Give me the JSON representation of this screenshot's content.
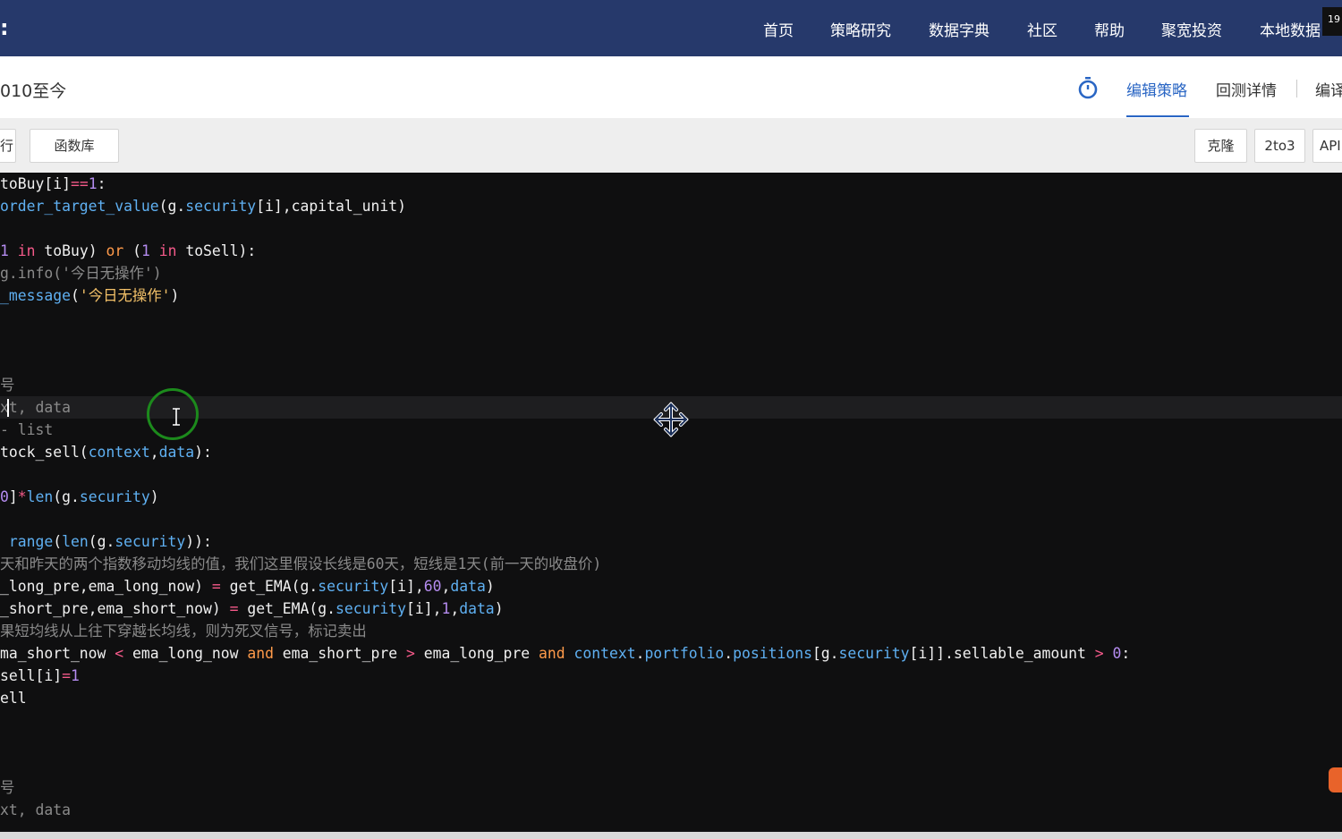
{
  "nav": {
    "logo_fragment": ":",
    "items": [
      "首页",
      "策略研究",
      "数据字典",
      "社区",
      "帮助",
      "聚宽投资",
      "本地数据"
    ],
    "corner_text": "19"
  },
  "title": {
    "text": "010至今",
    "tabs": [
      "编辑策略",
      "回测详情",
      "编译"
    ]
  },
  "toolbar": {
    "left_fragment": "行",
    "library": "函数库",
    "clone": "克隆",
    "py_convert": "2to3",
    "api": "API"
  },
  "editor": {
    "lines": [
      [
        [
          "toBuy[i]",
          "w"
        ],
        [
          "==",
          "kw"
        ],
        [
          "1",
          "num"
        ],
        [
          ":",
          "w"
        ]
      ],
      [
        [
          "order_target_value",
          "fn"
        ],
        [
          "(g.",
          "w"
        ],
        [
          "security",
          "fn"
        ],
        [
          "[i],capital_unit)",
          "w"
        ]
      ],
      [],
      [
        [
          "1 ",
          "num"
        ],
        [
          "in",
          "kw"
        ],
        [
          " toBuy) ",
          "w"
        ],
        [
          "or",
          "or"
        ],
        [
          " (",
          "w"
        ],
        [
          "1 ",
          "num"
        ],
        [
          "in",
          "kw"
        ],
        [
          " toSell):",
          "w"
        ]
      ],
      [
        [
          "g.info('今日无操作')",
          "cm"
        ]
      ],
      [
        [
          "_message",
          "fn"
        ],
        [
          "(",
          "w"
        ],
        [
          "'今日无操作'",
          "str"
        ],
        [
          ")",
          "w"
        ]
      ],
      [],
      [],
      [],
      [
        [
          "号",
          "cm"
        ]
      ],
      [
        [
          "xt, data",
          "cm"
        ]
      ],
      [
        [
          "- list",
          "cm"
        ]
      ],
      [
        [
          "tock_sell(",
          "w"
        ],
        [
          "context",
          "fn"
        ],
        [
          ",",
          "w"
        ],
        [
          "data",
          "fn"
        ],
        [
          "):",
          "w"
        ]
      ],
      [],
      [
        [
          "0",
          "num"
        ],
        [
          "]",
          "w"
        ],
        [
          "*",
          "kw"
        ],
        [
          "len",
          "fn"
        ],
        [
          "(g.",
          "w"
        ],
        [
          "security",
          "fn"
        ],
        [
          ")",
          "w"
        ]
      ],
      [],
      [
        [
          " ",
          "w"
        ],
        [
          "range",
          "fn"
        ],
        [
          "(",
          "w"
        ],
        [
          "len",
          "fn"
        ],
        [
          "(g.",
          "w"
        ],
        [
          "security",
          "fn"
        ],
        [
          ")):",
          "w"
        ]
      ],
      [
        [
          "天和昨天的两个指数移动均线的值，我们这里假设长线是60天，短线是1天(前一天的收盘价)",
          "cm"
        ]
      ],
      [
        [
          "_long_pre,ema_long_now) ",
          "w"
        ],
        [
          "=",
          "kw"
        ],
        [
          " get_EMA(g.",
          "w"
        ],
        [
          "security",
          "fn"
        ],
        [
          "[i],",
          "w"
        ],
        [
          "60",
          "num"
        ],
        [
          ",",
          "w"
        ],
        [
          "data",
          "fn"
        ],
        [
          ")",
          "w"
        ]
      ],
      [
        [
          "_short_pre,ema_short_now) ",
          "w"
        ],
        [
          "=",
          "kw"
        ],
        [
          " get_EMA(g.",
          "w"
        ],
        [
          "security",
          "fn"
        ],
        [
          "[i],",
          "w"
        ],
        [
          "1",
          "num"
        ],
        [
          ",",
          "w"
        ],
        [
          "data",
          "fn"
        ],
        [
          ")",
          "w"
        ]
      ],
      [
        [
          "果短均线从上往下穿越长均线，则为死叉信号，标记卖出",
          "cm"
        ]
      ],
      [
        [
          "ma_short_now ",
          "w"
        ],
        [
          "<",
          "kw"
        ],
        [
          " ema_long_now ",
          "w"
        ],
        [
          "and",
          "or"
        ],
        [
          " ema_short_pre ",
          "w"
        ],
        [
          ">",
          "kw"
        ],
        [
          " ema_long_pre ",
          "w"
        ],
        [
          "and",
          "or"
        ],
        [
          " ",
          "w"
        ],
        [
          "context",
          "fn"
        ],
        [
          ".",
          "w"
        ],
        [
          "portfolio",
          "fn"
        ],
        [
          ".",
          "w"
        ],
        [
          "positions",
          "fn"
        ],
        [
          "[g.",
          "w"
        ],
        [
          "security",
          "fn"
        ],
        [
          "[i]].sellable_amount ",
          "w"
        ],
        [
          ">",
          "kw"
        ],
        [
          " ",
          "w"
        ],
        [
          "0",
          "num"
        ],
        [
          ":",
          "w"
        ]
      ],
      [
        [
          "sell[i]",
          "w"
        ],
        [
          "=",
          "kw"
        ],
        [
          "1",
          "num"
        ]
      ],
      [
        [
          "ell",
          "w"
        ]
      ],
      [],
      [],
      [],
      [
        [
          "号",
          "cm"
        ]
      ],
      [
        [
          "xt, data",
          "cm"
        ]
      ]
    ]
  }
}
